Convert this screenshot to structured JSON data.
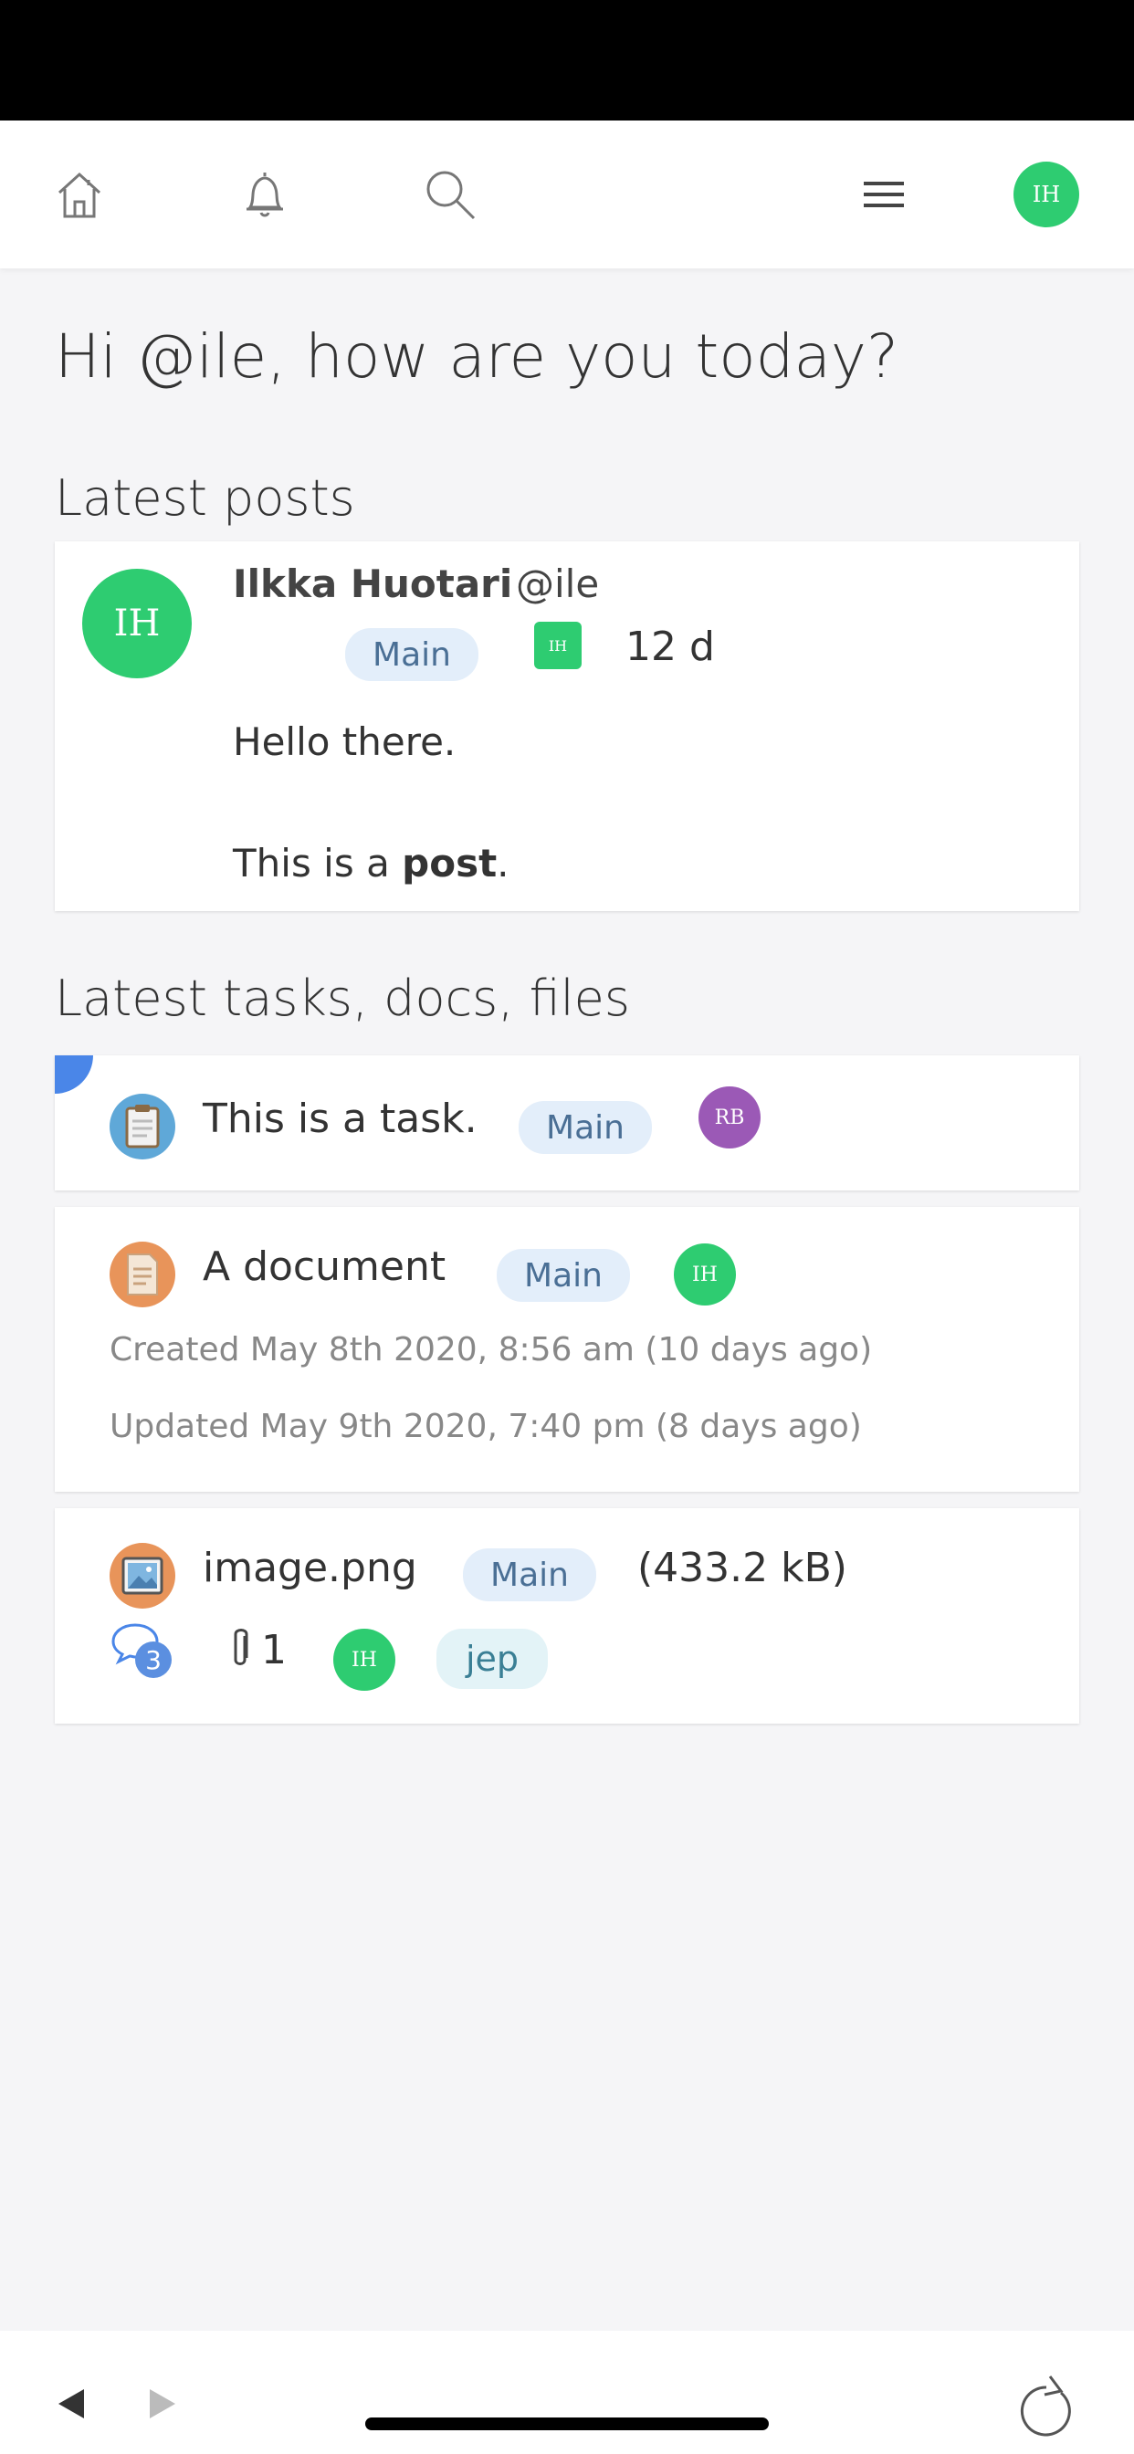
{
  "user": {
    "initials": "IH",
    "handle": "@ile"
  },
  "greeting": "Hi @ile, how are you today?",
  "sections": {
    "posts_title": "Latest posts",
    "items_title": "Latest tasks, docs, files"
  },
  "post": {
    "author_initials": "IH",
    "author_name": "Ilkka Huotari",
    "author_handle": "@ile",
    "project": "Main",
    "mini_avatar": "IH",
    "age": "12 d",
    "line1": "Hello there.",
    "line2_prefix": "This is a ",
    "line2_bold": "post",
    "line2_suffix": "."
  },
  "task": {
    "icon": "clipboard-icon",
    "title": "This is a task.",
    "project": "Main",
    "assignee_initials": "RB",
    "assignee_color": "#9b59b6"
  },
  "document": {
    "icon": "document-icon",
    "title": "A document",
    "project": "Main",
    "owner_initials": "IH",
    "created": "Created May 8th 2020, 8:56 am (10 days ago)",
    "updated": "Updated May 9th 2020, 7:40 pm (8 days ago)"
  },
  "file": {
    "icon": "image-file-icon",
    "title": "image.png",
    "project": "Main",
    "size": "(433.2 kB)",
    "comment_count": "3",
    "attachment_count": "1",
    "owner_initials": "IH",
    "tag": "jep"
  },
  "colors": {
    "accent_green": "#2ecc71",
    "chip_bg": "#e3eefa",
    "chip_text": "#4a6f95",
    "corner_blue": "#4a86e8"
  }
}
